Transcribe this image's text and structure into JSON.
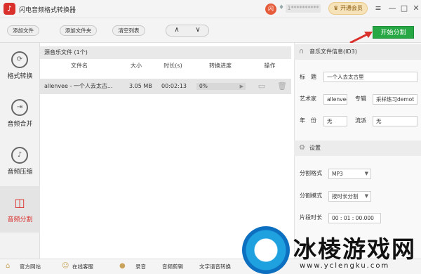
{
  "app": {
    "title": "闪电音频格式转换器",
    "avatar_text": "闪",
    "username": "1**********",
    "vip_label": "开通会员"
  },
  "window_controls": {
    "menu": "≡",
    "minimize": "—",
    "maximize": "□",
    "close": "✕"
  },
  "toolbar": {
    "add_file": "添加文件",
    "add_folder": "添加文件夹",
    "clear_list": "清空列表",
    "up": "∧",
    "down": "∨",
    "start": "开始分割"
  },
  "sidebar": {
    "items": [
      {
        "label": "格式转换",
        "icon": "convert-icon",
        "glyph": "⟳"
      },
      {
        "label": "音频合并",
        "icon": "merge-icon",
        "glyph": "⇥"
      },
      {
        "label": "音频压缩",
        "icon": "compress-icon",
        "glyph": "♪"
      },
      {
        "label": "音频分割",
        "icon": "split-icon",
        "glyph": "◫",
        "active": true
      }
    ]
  },
  "file_list": {
    "header": "源音乐文件 (1个)",
    "columns": [
      "文件名",
      "大小",
      "时长(s)",
      "转换进度",
      "操作"
    ],
    "rows": [
      {
        "name": "allenvee - 一个人去太古...",
        "size": "3.05 MB",
        "duration": "00:02:13",
        "progress": "0%",
        "progress_value": 0
      }
    ]
  },
  "id3": {
    "header": "音乐文件信息(ID3)",
    "title_label": "标　题",
    "title_value": "一个人去太古里",
    "artist_label": "艺术家",
    "artist_value": "allenvee",
    "album_label": "专辑",
    "album_value": "采样练习demot",
    "year_label": "年　份",
    "year_value": "无",
    "genre_label": "流派",
    "genre_value": "无"
  },
  "settings": {
    "header": "设置",
    "format_label": "分割格式",
    "format_value": "MP3",
    "mode_label": "分割模式",
    "mode_value": "按时长分割",
    "segment_label": "片段时长",
    "segment_value": "00 : 01 : 00.000"
  },
  "bottom": {
    "website": "官方网站",
    "service": "在线客服",
    "record": "录音",
    "cut": "音频剪辑",
    "tts": "文字语音转换"
  },
  "watermark": {
    "text": "冰棱游戏网",
    "url": "www.yclengku.com"
  },
  "colors": {
    "accent": "#d9302c",
    "start": "#28a745"
  }
}
